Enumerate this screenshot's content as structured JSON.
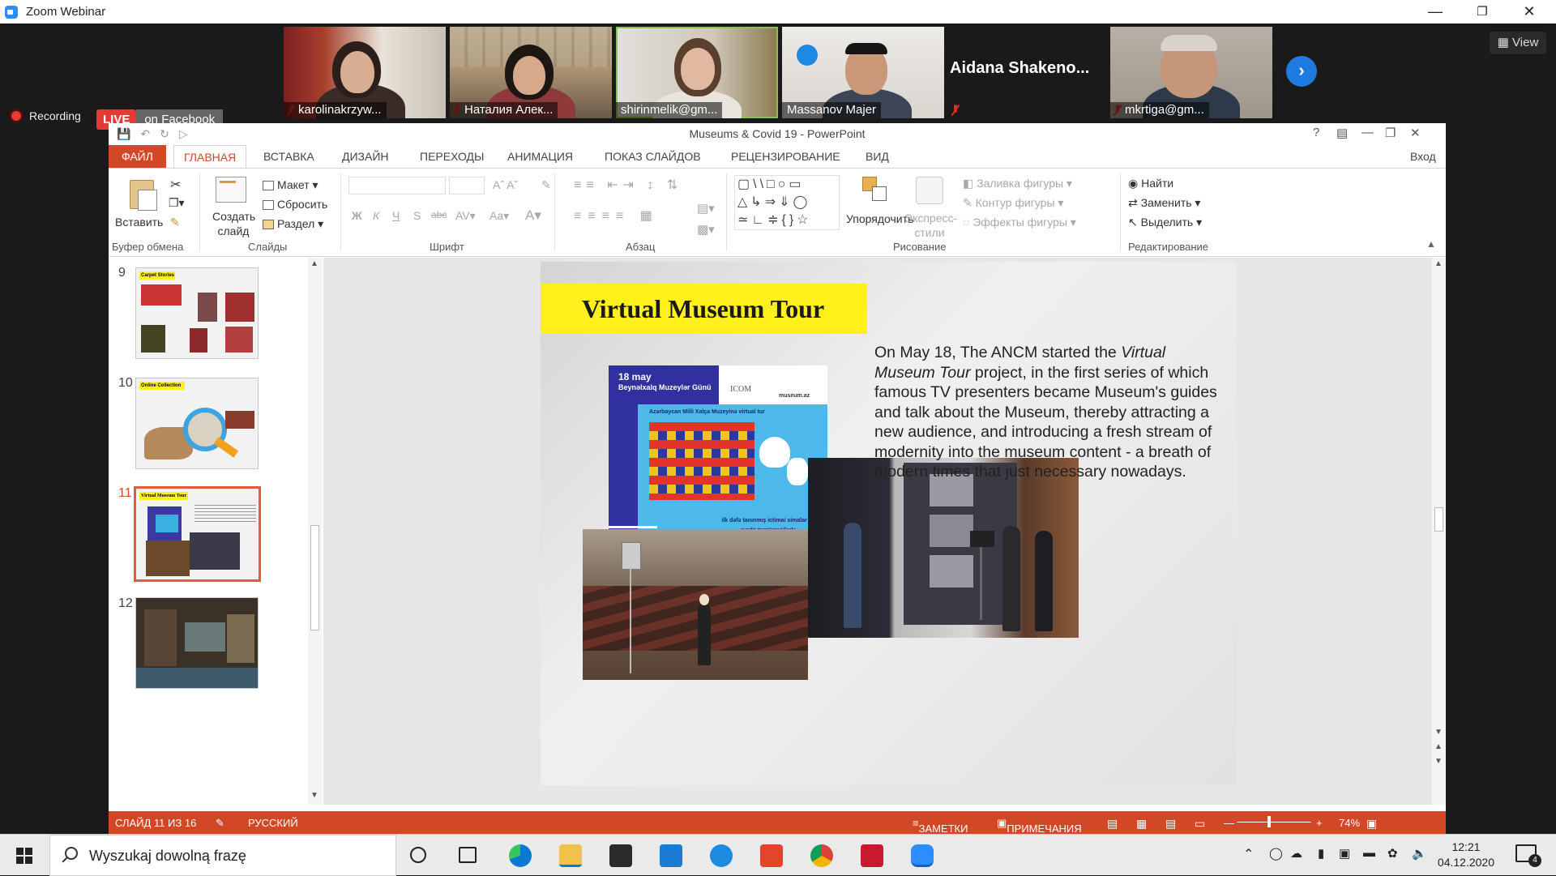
{
  "zoom": {
    "title": "Zoom Webinar",
    "view_label": "View",
    "recording_label": "Recording",
    "live_label": "LIVE",
    "live_target": "on Facebook",
    "participants": [
      {
        "name": "karolinakrzyw...",
        "muted": true
      },
      {
        "name": "Наталия Алек...",
        "muted": true
      },
      {
        "name": "shirinmelik@gm...",
        "muted": false,
        "active_speaker": true
      },
      {
        "name": "Massanov Majer",
        "muted": false
      },
      {
        "name": "Aidana Shakeno...",
        "muted": true,
        "video_off": true
      },
      {
        "name": "mkrtiga@gm...",
        "muted": true
      }
    ]
  },
  "ppt": {
    "window_title": "Museums & Covid 19 - PowerPoint",
    "signin_label": "Вход",
    "help_label": "?",
    "tabs": [
      {
        "label": "ФАЙЛ",
        "kind": "file"
      },
      {
        "label": "ГЛАВНАЯ",
        "kind": "active"
      },
      {
        "label": "ВСТАВКА"
      },
      {
        "label": "ДИЗАЙН"
      },
      {
        "label": "ПЕРЕХОДЫ"
      },
      {
        "label": "АНИМАЦИЯ"
      },
      {
        "label": "ПОКАЗ СЛАЙДОВ"
      },
      {
        "label": "РЕЦЕНЗИРОВАНИЕ"
      },
      {
        "label": "ВИД"
      }
    ],
    "ribbon": {
      "paste": "Вставить",
      "new_slide": "Создать слайд",
      "layout": "Макет",
      "reset": "Сбросить",
      "section": "Раздел",
      "bold": "Ж",
      "italic": "К",
      "underline": "Ч",
      "shadow": "S",
      "strike": "abc",
      "arrange": "Упорядочить",
      "quick_styles": "Экспресс-стили",
      "shape_fill": "Заливка фигуры",
      "shape_outline": "Контур фигуры",
      "shape_effects": "Эффекты фигуры",
      "find": "Найти",
      "replace": "Заменить",
      "select": "Выделить",
      "groups": {
        "clipboard": "Буфер обмена",
        "slides": "Слайды",
        "font": "Шрифт",
        "paragraph": "Абзац",
        "drawing": "Рисование",
        "editing": "Редактирование"
      }
    },
    "thumbnails": [
      {
        "num": "9",
        "title": "Carpet Stories"
      },
      {
        "num": "10",
        "title": "Online Collection"
      },
      {
        "num": "11",
        "title": "Virtual Museum Tour",
        "selected": true
      },
      {
        "num": "12",
        "title": ""
      }
    ],
    "slide": {
      "title": "Virtual Museum Tour",
      "text_before_em": "On May 18, The ANCM started the ",
      "text_em": "Virtual Museum Tour",
      "text_after_em": " project, in the first series of which famous TV presenters became Museum's guides and talk about the Museum, thereby attracting a new audience, and introducing a fresh stream of modernity into the museum content - a breath of modern times that just necessary nowadays.",
      "poster": {
        "date": "18 may",
        "subtitle": "Beynəlxalq Muzeylər Günü",
        "icom": "ICOM",
        "site": "museum.az",
        "headline": "Azərbaycan Milli Xalça Muzeyinə virtual tur",
        "caption": "ilk dəfə tanınmış ictimai simalar və surdo tərcüməçilərlə"
      }
    },
    "status": {
      "slide_counter": "СЛАЙД 11 ИЗ 16",
      "language": "РУССКИЙ",
      "notes": "ЗАМЕТКИ",
      "comments": "ПРИМЕЧАНИЯ",
      "zoom": "74%"
    }
  },
  "taskbar": {
    "search_placeholder": "Wyszukaj dowolną frazę",
    "time": "12:21",
    "date": "04.12.2020",
    "notification_count": "4"
  },
  "colors": {
    "ppt_accent": "#d24726",
    "zoom_blue": "#2d8cff",
    "slide_title_bg": "#ffef1a"
  }
}
